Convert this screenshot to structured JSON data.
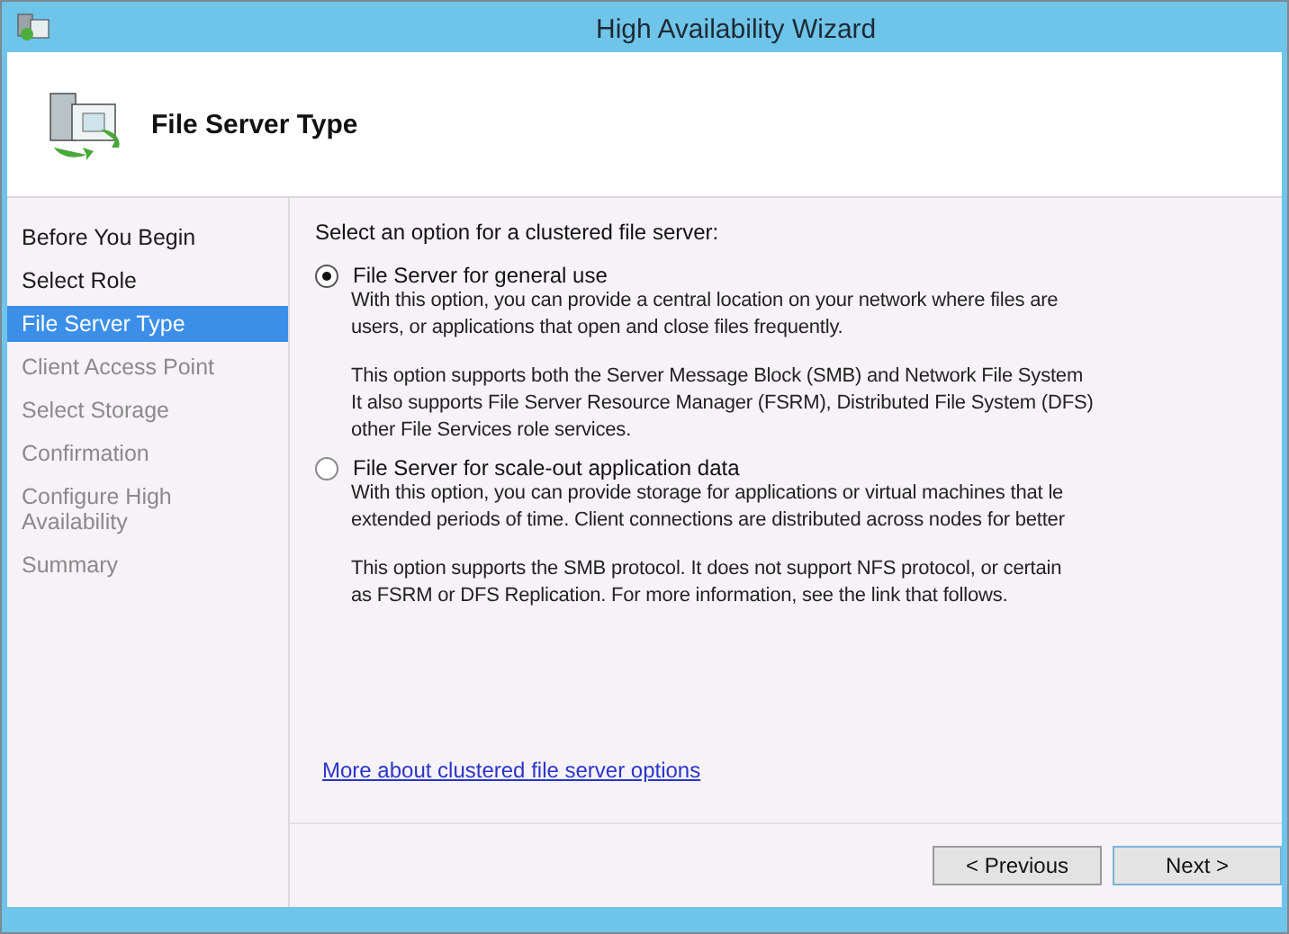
{
  "window": {
    "title": "High Availability Wizard"
  },
  "header": {
    "title": "File Server Type"
  },
  "nav": [
    {
      "label": "Before You Begin",
      "selected": false,
      "disabled": false
    },
    {
      "label": "Select Role",
      "selected": false,
      "disabled": false
    },
    {
      "label": "File Server Type",
      "selected": true,
      "disabled": false
    },
    {
      "label": "Client Access Point",
      "selected": false,
      "disabled": true
    },
    {
      "label": "Select Storage",
      "selected": false,
      "disabled": true
    },
    {
      "label": "Confirmation",
      "selected": false,
      "disabled": true
    },
    {
      "label": "Configure High Availability",
      "selected": false,
      "disabled": true
    },
    {
      "label": "Summary",
      "selected": false,
      "disabled": true
    }
  ],
  "prompt": "Select an option for a clustered file server:",
  "options": [
    {
      "label": "File Server for general use",
      "selected": true,
      "paragraphs": [
        [
          "With this option, you can provide a central location on your network where files are",
          "users, or applications that open and close files frequently."
        ],
        [
          "This option supports both the Server Message Block (SMB) and Network File System",
          "It also supports File Server Resource Manager (FSRM), Distributed File System (DFS)",
          "other File Services role services."
        ]
      ]
    },
    {
      "label": "File Server for scale-out application data",
      "selected": false,
      "paragraphs": [
        [
          "With this option, you can provide storage for applications or virtual machines that le",
          "extended periods of time. Client connections are distributed across nodes for better"
        ],
        [
          "This option supports the SMB protocol. It does not support NFS protocol, or certain",
          "as FSRM or DFS Replication. For more information, see the link that follows."
        ]
      ]
    }
  ],
  "link": "More about clustered file server options",
  "buttons": [
    "< Previous",
    "Next >"
  ]
}
